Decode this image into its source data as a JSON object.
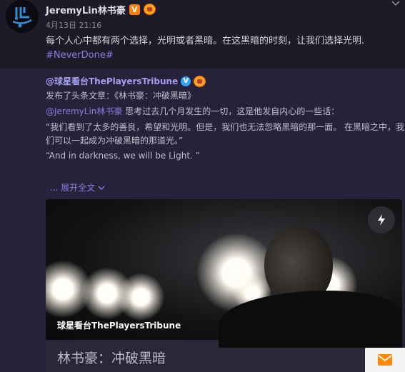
{
  "post": {
    "author": "JeremyLin林书豪",
    "time": "4月13日 21:16",
    "text": "每个人心中都有两个选择，光明或者黑暗。在这黑暗的时刻，让我们选择光明.",
    "hashtag": "#NeverDone#",
    "badge_label": "V"
  },
  "repost": {
    "author": "@球星看台ThePlayersTribune",
    "headline": "发布了头条文章：《林书豪：冲破黑暗》",
    "mention": "@JeremyLin林书豪",
    "line2_rest": " 思考过去几个月发生的一切，这是他发自内心的一些话：",
    "line3": "“我们看到了太多的善良，希望和光明。但是，我们也无法忽略黑暗的那一面。 在黑暗之中，我",
    "line4": "们可以一起成为冲破黑暗的那道光。”",
    "line5": "“And in darkness, we will be Light. ”",
    "expand": "... 展开全文",
    "verified_label": "V"
  },
  "card": {
    "source": "球星看台ThePlayersTribune",
    "title": "林书豪：冲破黑暗"
  },
  "colors": {
    "background": "#1e1b29",
    "repost_background": "#26223a",
    "link": "#8a7fe0",
    "verified_orange": "#ff8200",
    "verified_blue": "#2ea4ff"
  },
  "icons": {
    "avatar": "jl-logo-icon",
    "flash": "lightning-icon",
    "mail": "mail-icon",
    "chevron": "chevron-down-icon"
  }
}
